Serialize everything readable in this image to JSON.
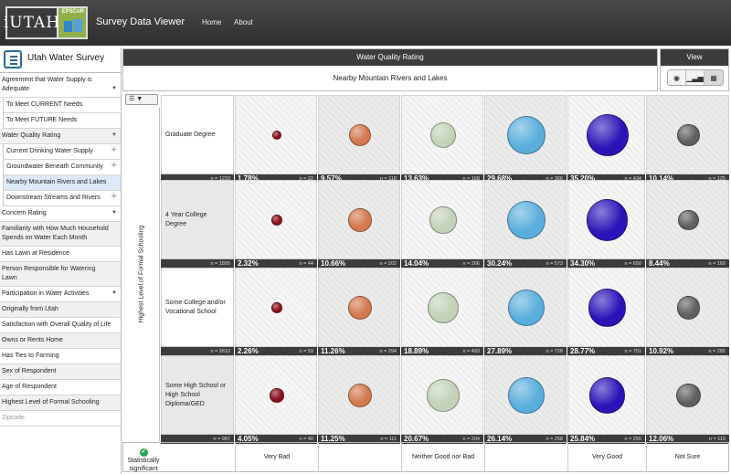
{
  "header": {
    "logo_text": "iUTAH",
    "logo_badge": "EPSCoR",
    "app_title": "Survey Data Viewer",
    "nav": [
      "Home",
      "About"
    ]
  },
  "sidebar": {
    "title": "Utah Water Survey",
    "items": [
      {
        "label": "Agreement that Water Supply is Adequate",
        "style": "plain",
        "arrow": true
      },
      {
        "label": "To Meet CURRENT Needs",
        "style": "sub"
      },
      {
        "label": "To Meet FUTURE Needs",
        "style": "sub"
      },
      {
        "label": "Water Quality Rating",
        "style": "grey",
        "arrow": true
      },
      {
        "label": "Current Drinking Water Supply",
        "style": "sub",
        "plus": true
      },
      {
        "label": "Groundwater Beneath Community",
        "style": "sub",
        "plus": true
      },
      {
        "label": "Nearby Mountain Rivers and Lakes",
        "style": "sub-selected"
      },
      {
        "label": "Downstream Streams and Rivers",
        "style": "sub",
        "plus": true
      },
      {
        "label": "Concern Rating",
        "style": "plain",
        "arrow": true
      },
      {
        "label": "Familiarity with How Much Household Spends on Water Each Month",
        "style": "grey"
      },
      {
        "label": "Has Lawn at Residence",
        "style": "plain"
      },
      {
        "label": "Person Responsible for Watering Lawn",
        "style": "grey"
      },
      {
        "label": "Participation in Water Activities",
        "style": "plain",
        "arrow": true
      },
      {
        "label": "Originally from Utah",
        "style": "grey"
      },
      {
        "label": "Satisfaction with Overall Quality of Life",
        "style": "plain"
      },
      {
        "label": "Owns or Rents Home",
        "style": "grey"
      },
      {
        "label": "Has Ties to Farming",
        "style": "plain"
      },
      {
        "label": "Sex of Respondent",
        "style": "grey"
      },
      {
        "label": "Age of Respondent",
        "style": "plain"
      },
      {
        "label": "Highest Level of Formal Schooling",
        "style": "grey"
      },
      {
        "label": "Zipcode",
        "style": "muted"
      }
    ]
  },
  "main": {
    "section_title": "Water Quality Rating",
    "question": "Nearby Mountain Rivers and Lakes",
    "view_title": "View",
    "view_icons": [
      "map-pin-icon",
      "bar-chart-icon",
      "grid-icon"
    ],
    "y_axis_label": "Highest Level of Formal Schooling",
    "rows": [
      {
        "label": "Graduate Degree",
        "n": "n = 1233",
        "cells": [
          {
            "pct": "1.78%",
            "n": "n = 22"
          },
          {
            "pct": "9.57%",
            "n": "n = 118"
          },
          {
            "pct": "13.63%",
            "n": "n = 168"
          },
          {
            "pct": "29.68%",
            "n": "n = 366"
          },
          {
            "pct": "35.20%",
            "n": "n = 434"
          },
          {
            "pct": "10.14%",
            "n": "n = 125"
          }
        ]
      },
      {
        "label": "4 Year College Degree",
        "n": "n = 1895",
        "cells": [
          {
            "pct": "2.32%",
            "n": "n = 44"
          },
          {
            "pct": "10.66%",
            "n": "n = 202"
          },
          {
            "pct": "14.04%",
            "n": "n = 266"
          },
          {
            "pct": "30.24%",
            "n": "n = 573"
          },
          {
            "pct": "34.30%",
            "n": "n = 650"
          },
          {
            "pct": "8.44%",
            "n": "n = 160"
          }
        ]
      },
      {
        "label": "Some College and/or Vocational School",
        "n": "n = 2610",
        "cells": [
          {
            "pct": "2.26%",
            "n": "n = 59"
          },
          {
            "pct": "11.26%",
            "n": "n = 294"
          },
          {
            "pct": "18.89%",
            "n": "n = 493"
          },
          {
            "pct": "27.89%",
            "n": "n = 728"
          },
          {
            "pct": "28.77%",
            "n": "n = 751"
          },
          {
            "pct": "10.92%",
            "n": "n = 285"
          }
        ]
      },
      {
        "label": "Some High School or High School Diploma/GED",
        "n": "n = 987",
        "cells": [
          {
            "pct": "4.05%",
            "n": "n = 40"
          },
          {
            "pct": "11.25%",
            "n": "n = 111"
          },
          {
            "pct": "20.67%",
            "n": "n = 204"
          },
          {
            "pct": "26.14%",
            "n": "n = 258"
          },
          {
            "pct": "25.84%",
            "n": "n = 255"
          },
          {
            "pct": "12.06%",
            "n": "n = 119"
          }
        ]
      }
    ],
    "bubble_colors": [
      "#8c0f1e",
      "#d2794f",
      "#c3d2b8",
      "#5aaedc",
      "#2a14b8",
      "#606060"
    ],
    "bubble_scale_pct": [
      1.78,
      9.57,
      13.63,
      29.68,
      35.2,
      10.14,
      2.32,
      10.66,
      14.04,
      30.24,
      34.3,
      8.44,
      2.26,
      11.26,
      18.89,
      27.89,
      28.77,
      10.92,
      4.05,
      11.25,
      20.67,
      26.14,
      25.84,
      12.06
    ],
    "footer": {
      "significance": "Statistically significant",
      "columns": [
        "Very Bad",
        "",
        "Neither Good nor Bad",
        "",
        "Very Good",
        "Not Sure"
      ]
    }
  }
}
